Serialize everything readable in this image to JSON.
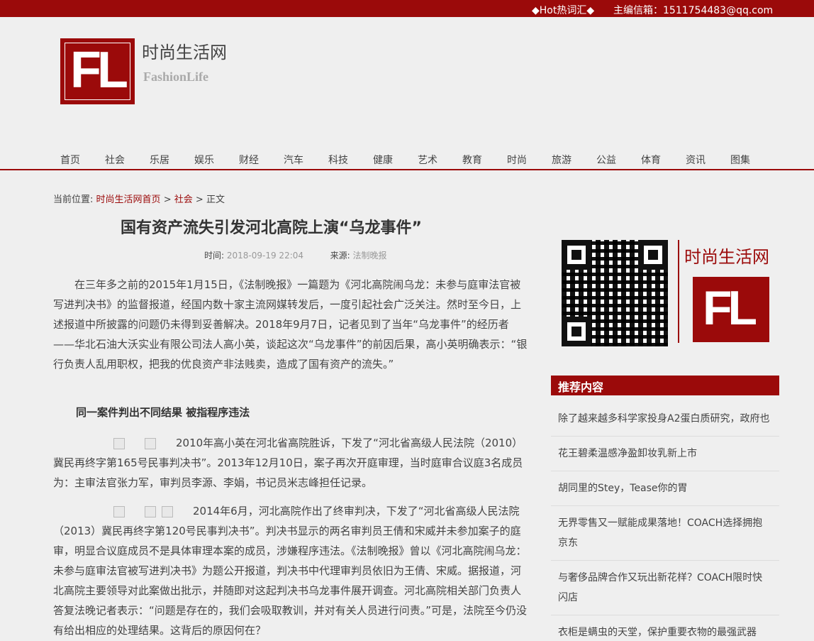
{
  "topbar": {
    "hot": "◆Hot热词汇◆",
    "mail": "主编信箱：1511754483@qq.com"
  },
  "brand": {
    "cn": "时尚生活网",
    "en": "FashionLife",
    "logo_text": "FL"
  },
  "nav": [
    "首页",
    "社会",
    "乐居",
    "娱乐",
    "财经",
    "汽车",
    "科技",
    "健康",
    "艺术",
    "教育",
    "时尚",
    "旅游",
    "公益",
    "体育",
    "资讯",
    "图集"
  ],
  "breadcrumb": {
    "prefix": "当前位置:",
    "home": "时尚生活网首页",
    "sep1": ">",
    "section": "社会",
    "sep2": ">",
    "current": "正文"
  },
  "article": {
    "title": "国有资产流失引发河北高院上演“乌龙事件”",
    "time_label": "时间:",
    "time": "2018-09-19 22:04",
    "source_label": "来源:",
    "source": "法制晚报",
    "p1": "在三年多之前的2015年1月15日，《法制晚报》一篇题为《河北高院闹乌龙：未参与庭审法官被写进判决书》的监督报道，经国内数十家主流网媒转发后，一度引起社会广泛关注。然时至今日，上述报道中所披露的问题仍未得到妥善解决。2018年9月7日，记者见到了当年“乌龙事件”的经历者——华北石油大沃实业有限公司法人高小英，谈起这次“乌龙事件”的前因后果，高小英明确表示：“银行负责人乱用职权，把我的优良资产非法贱卖，造成了国有资产的流失。”",
    "subhead": "同一案件判出不同结果 被指程序违法",
    "p2": "2010年高小英在河北省高院胜诉，下发了“河北省高级人民法院（2010）冀民再终字第165号民事判决书”。2013年12月10日，案子再次开庭审理，当时庭审合议庭3名成员为：主审法官张力军，审判员李源、李娟，书记员米志峰担任记录。",
    "p3": "2014年6月，河北高院作出了终审判决，下发了“河北省高级人民法院（2013）冀民再终字第120号民事判决书”。判决书显示的两名审判员王倩和宋威并未参加案子的庭审，明显合议庭成员不是具体审理本案的成员，涉嫌程序违法。《法制晚报》曾以《河北高院闹乌龙：未参与庭审法官被写进判决书》为题公开报道，判决书中代理审判员依旧为王倩、宋威。据报道，河北高院主要领导对此案做出批示，并随即对这起判决书乌龙事件展开调查。河北高院相关部门负责人答复法晚记者表示：“问题是存在的，我们会吸取教训，并对有关人员进行问责。”可是，法院至今仍没有给出相应的处理结果。这背后的原因何在？"
  },
  "sidebar": {
    "brand_cn": "时尚生活网",
    "rec_title": "推荐内容",
    "items": [
      "除了越来越多科学家投身A2蛋白质研究，政府也",
      "花王碧柔温感净盈卸妆乳新上市",
      "胡同里的Stey，Tease你的胃",
      "无界零售又一赋能成果落地！COACH选择拥抱京东",
      "与奢侈品牌合作又玩出新花样？COACH限时快闪店",
      "衣柜是螨虫的天堂，保护重要衣物的最强武器"
    ]
  },
  "colors": {
    "brand_red": "#9b0a0a",
    "background": "#efefef"
  }
}
